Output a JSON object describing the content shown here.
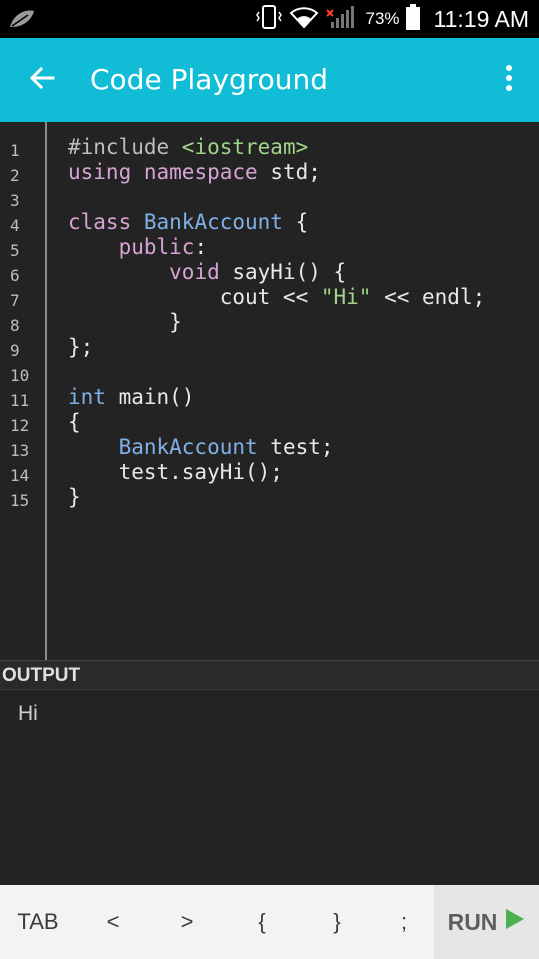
{
  "status_bar": {
    "battery_percent": "73%",
    "time": "11:19 AM",
    "icons": [
      "leaf-icon",
      "vibrate-icon",
      "wifi-icon",
      "signal-icon",
      "battery-icon"
    ]
  },
  "app_bar": {
    "title": "Code Playground",
    "back_icon": "arrow-left-icon",
    "menu_icon": "more-vert-icon",
    "color": "#10bcd6"
  },
  "editor": {
    "line_numbers": [
      "1",
      "2",
      "3",
      "4",
      "5",
      "6",
      "7",
      "8",
      "9",
      "10",
      "11",
      "12",
      "13",
      "14",
      "15"
    ],
    "lines": [
      [
        {
          "t": "#include ",
          "c": "pp"
        },
        {
          "t": "<iostream>",
          "c": "st"
        }
      ],
      [
        {
          "t": "using",
          "c": "kw"
        },
        {
          "t": " ",
          "c": ""
        },
        {
          "t": "namespace",
          "c": "kw"
        },
        {
          "t": " std;",
          "c": ""
        }
      ],
      [],
      [
        {
          "t": "class",
          "c": "kw"
        },
        {
          "t": " ",
          "c": ""
        },
        {
          "t": "BankAccount",
          "c": "ty"
        },
        {
          "t": " {",
          "c": ""
        }
      ],
      [
        {
          "t": "    ",
          "c": ""
        },
        {
          "t": "public",
          "c": "kw"
        },
        {
          "t": ":",
          "c": ""
        }
      ],
      [
        {
          "t": "        ",
          "c": ""
        },
        {
          "t": "void",
          "c": "kw"
        },
        {
          "t": " sayHi() {",
          "c": ""
        }
      ],
      [
        {
          "t": "            cout << ",
          "c": ""
        },
        {
          "t": "\"Hi\"",
          "c": "st"
        },
        {
          "t": " << endl;",
          "c": ""
        }
      ],
      [
        {
          "t": "        }",
          "c": ""
        }
      ],
      [
        {
          "t": "};",
          "c": ""
        }
      ],
      [],
      [
        {
          "t": "int",
          "c": "ty"
        },
        {
          "t": " main()",
          "c": ""
        }
      ],
      [
        {
          "t": "{",
          "c": ""
        }
      ],
      [
        {
          "t": "    ",
          "c": ""
        },
        {
          "t": "BankAccount",
          "c": "ty"
        },
        {
          "t": " test;",
          "c": ""
        }
      ],
      [
        {
          "t": "    test.sayHi();",
          "c": ""
        }
      ],
      [
        {
          "t": "}",
          "c": ""
        }
      ]
    ]
  },
  "output": {
    "header": "OUTPUT",
    "text": "Hi"
  },
  "keybar": {
    "keys": [
      "TAB",
      "<",
      ">",
      "{",
      "}",
      ";"
    ],
    "run_label": "RUN",
    "run_icon": "play-icon",
    "run_icon_color": "#4caf50"
  }
}
